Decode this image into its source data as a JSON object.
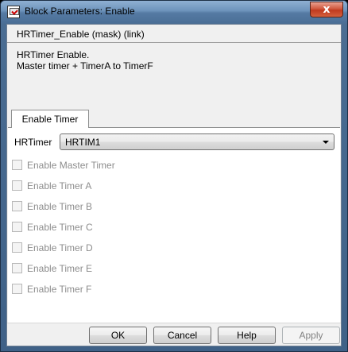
{
  "window": {
    "title": "Block Parameters: Enable",
    "close_symbol": "x"
  },
  "header": {
    "title": "HRTimer_Enable (mask) (link)",
    "description_line1": "HRTimer Enable.",
    "description_line2": "Master timer + TimerA to TimerF"
  },
  "tabs": [
    {
      "label": "Enable Timer",
      "selected": true
    }
  ],
  "hrtimer": {
    "label": "HRTimer",
    "selected_value": "HRTIM1"
  },
  "options": [
    {
      "label": "Enable Master Timer",
      "checked": false,
      "enabled": false
    },
    {
      "label": "Enable Timer A",
      "checked": false,
      "enabled": false
    },
    {
      "label": "Enable Timer B",
      "checked": false,
      "enabled": false
    },
    {
      "label": "Enable Timer C",
      "checked": false,
      "enabled": false
    },
    {
      "label": "Enable Timer D",
      "checked": false,
      "enabled": false
    },
    {
      "label": "Enable Timer E",
      "checked": false,
      "enabled": false
    },
    {
      "label": "Enable Timer F",
      "checked": false,
      "enabled": false
    }
  ],
  "buttons": {
    "ok": "OK",
    "cancel": "Cancel",
    "help": "Help",
    "apply": "Apply",
    "apply_enabled": false
  },
  "colors": {
    "titlebar": "#6d93bb",
    "close_button": "#c03a1f",
    "disabled_text": "#8d8d8d"
  },
  "icons": {
    "app": "simulink-block-icon",
    "close": "close-icon",
    "dropdown": "chevron-down-icon"
  }
}
